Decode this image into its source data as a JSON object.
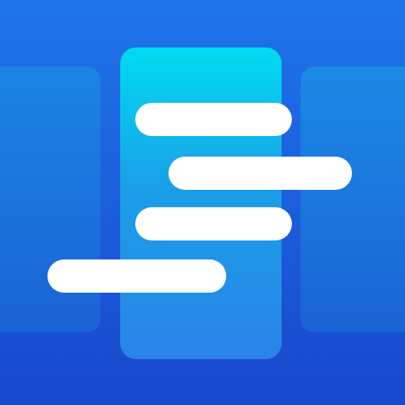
{
  "app_icon": {
    "icon": "kanban-timeline-icon",
    "colors": {
      "background_top": "#1f74ea",
      "background_bottom": "#1848cd",
      "side_columns": "#1a6fdc",
      "center_column_top": "#00dcf0",
      "center_column_bottom": "#2a84e8",
      "bars": "#ffffff"
    },
    "columns": [
      "left-column",
      "center-column",
      "right-column"
    ],
    "bar_count": 4
  }
}
